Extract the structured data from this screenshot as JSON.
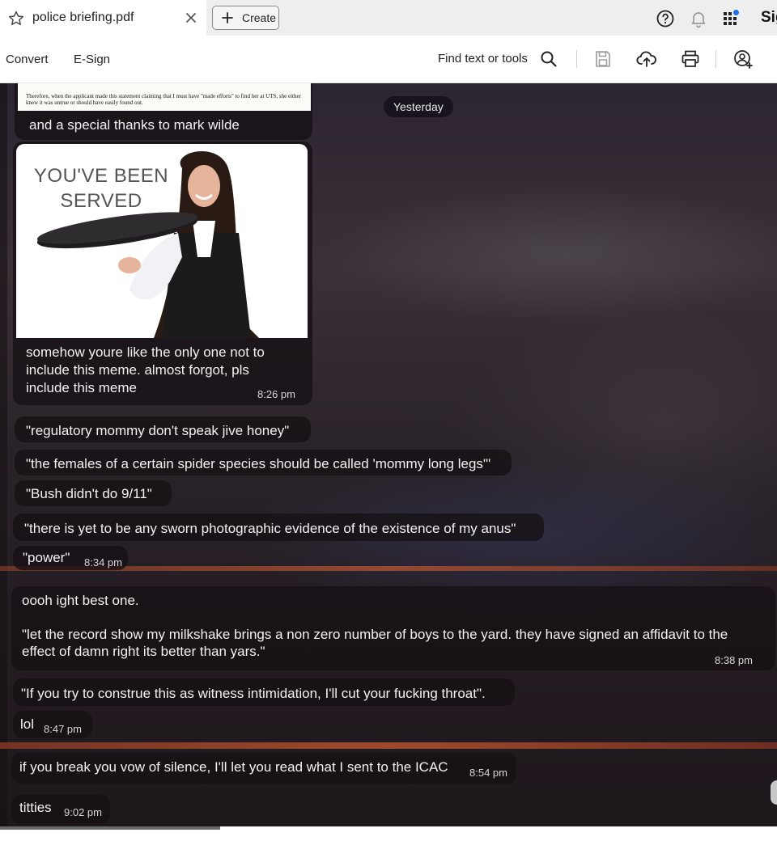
{
  "tab": {
    "title": "police briefing.pdf"
  },
  "toolbar_top": {
    "create_label": "Create",
    "sign_label": "Sig"
  },
  "menu": {
    "convert": "Convert",
    "esign": "E-Sign",
    "find": "Find text or tools"
  },
  "icons": {
    "star": "star-icon",
    "close": "close-icon",
    "plus": "plus-icon",
    "help": "help-icon",
    "bell": "bell-icon",
    "apps": "apps-icon",
    "search": "search-icon",
    "save": "save-icon",
    "upload": "upload-cloud-icon",
    "print": "print-icon",
    "share": "share-user-icon"
  },
  "colors": {
    "accent_dot": "#1a73e8",
    "chat_bubble": "#1c1418",
    "streak": "#b5582f"
  },
  "chat": {
    "date_divider": "Yesterday",
    "doc_excerpt": "Therefore, when the applicant made this statement claiming that I must have \"made efforts\" to find her at UTS, she either knew it was untrue or should have easily found out.",
    "messages": [
      {
        "text": "and a special thanks to mark wilde",
        "time": ""
      },
      {
        "image_caption": "YOU'VE BEEN SERVED"
      },
      {
        "text_lines": [
          "somehow youre like the only one not to",
          "include this meme. almost forgot, pls",
          "include this meme"
        ],
        "time": "8:26 pm"
      },
      {
        "text": "\"regulatory mommy don't speak jive honey\"",
        "time": ""
      },
      {
        "text": "\"the females of a certain spider species should be called 'mommy long legs'\"",
        "time": ""
      },
      {
        "text": "\"Bush didn't do 9/11\"",
        "time": ""
      },
      {
        "text": "\"there is yet to be any sworn photographic evidence of the existence of my anus\"",
        "time": ""
      },
      {
        "text": "\"power\"",
        "time": "8:34 pm"
      },
      {
        "text": "oooh ight best one.",
        "time": ""
      },
      {
        "text_lines": [
          "\"let the record show my milkshake brings a non zero number of boys to the yard. they have signed an affidavit to the",
          "effect of damn right its better than yars.\""
        ],
        "time": "8:38 pm"
      },
      {
        "text": "\"If you try to construe this as witness intimidation, I'll cut your fucking throat\".",
        "time": ""
      },
      {
        "text": "lol",
        "time": "8:47 pm"
      },
      {
        "text": "if you break you vow of silence, I'll let you read what I sent to the ICAC",
        "time": "8:54 pm"
      },
      {
        "text": "titties",
        "time": "9:02 pm"
      }
    ]
  }
}
